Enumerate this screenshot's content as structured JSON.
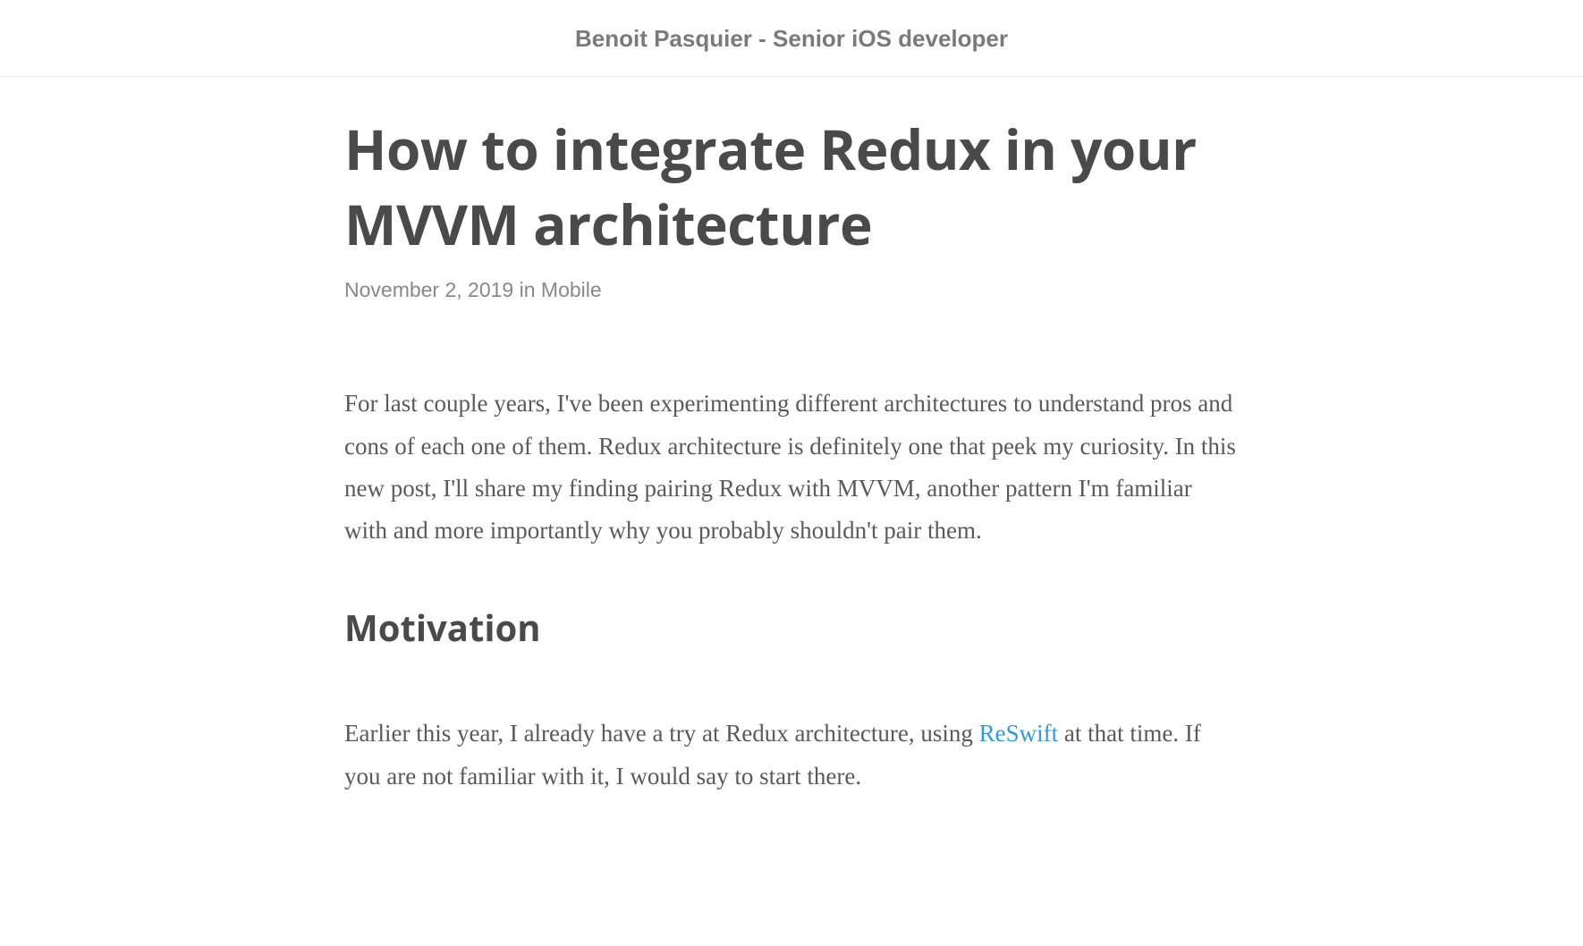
{
  "header": {
    "title": "Benoit Pasquier - Senior iOS developer"
  },
  "article": {
    "title": "How to integrate Redux in your MVVM architecture",
    "date": "November 2, 2019",
    "meta_in": " in ",
    "category": "Mobile",
    "intro": "For last couple years, I've been experimenting different architectures to understand pros and cons of each one of them. Redux architecture is definitely one that peek my curiosity. In this new post, I'll share my finding pairing Redux with MVVM, another pattern I'm familiar with and more importantly why you probably shouldn't pair them.",
    "section_heading": "Motivation",
    "para2_part1": "Earlier this year, I already have a try at Redux architecture, using ",
    "para2_link": "ReSwift",
    "para2_part2": " at that time. If you are not familiar with it, I would say to start there."
  }
}
